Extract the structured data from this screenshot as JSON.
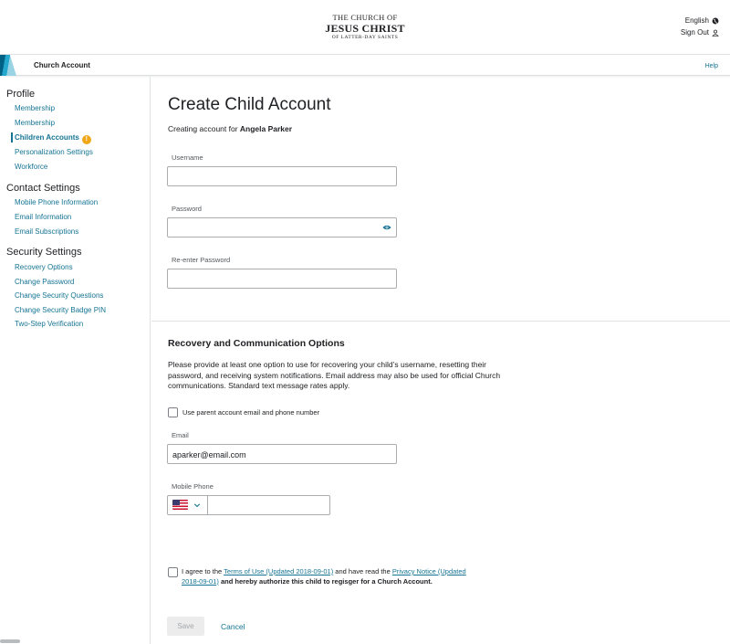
{
  "header": {
    "logo_line1": "THE CHURCH OF",
    "logo_line2": "JESUS CHRIST",
    "logo_line3": "OF LATTER-DAY SAINTS",
    "language": "English",
    "sign_out": "Sign Out"
  },
  "subnav": {
    "title": "Church Account",
    "help": "Help"
  },
  "sidebar": {
    "profile": {
      "heading": "Profile",
      "items": [
        "Membership",
        "Membership",
        "Children Accounts",
        "Personalization Settings",
        "Workforce"
      ],
      "badge": "!"
    },
    "contact": {
      "heading": "Contact Settings",
      "items": [
        "Mobile Phone Information",
        "Email Information",
        "Email Subscriptions"
      ]
    },
    "security": {
      "heading": "Security Settings",
      "items": [
        "Recovery Options",
        "Change Password",
        "Change Security Questions",
        "Change Security Badge PIN",
        "Two-Step Verification"
      ]
    }
  },
  "form": {
    "title": "Create Child Account",
    "creating_prefix": "Creating account for ",
    "child_name": "Angela Parker",
    "username_label": "Username",
    "username_value": "",
    "password_label": "Password",
    "password_value": "",
    "reenter_label": "Re-enter Password",
    "reenter_value": "",
    "recovery_heading": "Recovery and Communication Options",
    "recovery_text": "Please provide at least one option to use for recovering your child’s username, resetting their password, and receiving system notifications. Email address may also be used for official Church communications. Standard text message rates apply.",
    "use_parent_label": "Use parent account email and phone number",
    "use_parent_checked": false,
    "email_label": "Email",
    "email_value": "aparker@email.com",
    "phone_label": "Mobile Phone",
    "phone_value": "",
    "agree_prefix": "I agree to the ",
    "terms_link": "Terms of Use (Updated 2018-09-01)",
    "agree_mid": " and have read the ",
    "privacy_link": "Privacy Notice (Updated 2018-09-01)",
    "agree_suffix": " and hereby authorize this child to regisger for a Church Account.",
    "agree_checked": false,
    "save_label": "Save",
    "cancel_label": "Cancel"
  },
  "colors": {
    "link": "#157493",
    "badge": "#f0a719",
    "disabled_button_bg": "#ececed"
  }
}
